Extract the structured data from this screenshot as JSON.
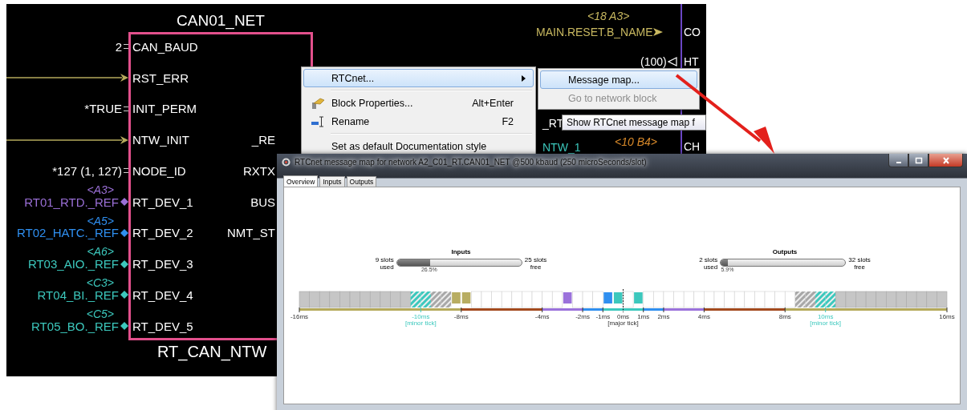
{
  "schematic": {
    "block_title": "CAN01_NET",
    "block_type": "RT_CAN_NTW",
    "pins": [
      {
        "name": "CAN_BAUD",
        "kind": "const",
        "value": "2"
      },
      {
        "name": "RST_ERR",
        "kind": "wire"
      },
      {
        "name": "INIT_PERM",
        "kind": "const",
        "value": "*TRUE"
      },
      {
        "name": "NTW_INIT",
        "kind": "wire",
        "output": "_RE"
      },
      {
        "name": "NODE_ID",
        "kind": "const",
        "value": "*127 (1, 127)",
        "output": "RXTX"
      },
      {
        "name": "RT_DEV_1",
        "kind": "ref",
        "tag": "<A3>",
        "value": "RT01_RTD._REF",
        "color": "#9a6fd6",
        "output": "BUS"
      },
      {
        "name": "RT_DEV_2",
        "kind": "ref",
        "tag": "<A5>",
        "value": "RT02_HATC._REF",
        "color": "#2f8ff0",
        "output": "NMT_ST"
      },
      {
        "name": "RT_DEV_3",
        "kind": "ref",
        "tag": "<A6>",
        "value": "RT03_AIO._REF",
        "color": "#3cc8bd"
      },
      {
        "name": "RT_DEV_4",
        "kind": "ref",
        "tag": "<C3>",
        "value": "RT04_BI._REF",
        "color": "#3cc8bd"
      },
      {
        "name": "RT_DEV_5",
        "kind": "ref",
        "tag": "<C5>",
        "value": "RT05_BO._REF",
        "color": "#3cc8bd"
      }
    ],
    "fragments": [
      {
        "text": "<18 A3>",
        "kind": "tag",
        "color": "#c8b860"
      },
      {
        "text": "MAIN.RESET.B_NAME",
        "kind": "input",
        "color": "#c8b860"
      },
      {
        "text": "CO",
        "kind": "pin"
      },
      {
        "text": "(100)",
        "kind": "output"
      },
      {
        "text": "HT",
        "kind": "pin"
      },
      {
        "text": "_RT",
        "kind": "pin"
      },
      {
        "text": "NTW_1",
        "kind": "pin",
        "color": "#3cc8bd"
      },
      {
        "text": "<10 B4>",
        "kind": "tag",
        "color": "#d98a2a"
      },
      {
        "text": "CH",
        "kind": "pin"
      }
    ]
  },
  "context_menu": {
    "items": [
      {
        "kind": "item",
        "label": "RTCnet...",
        "submenu": true,
        "selected": true
      },
      {
        "kind": "separator"
      },
      {
        "kind": "item",
        "label": "Block Properties...",
        "shortcut": "Alt+Enter",
        "selected": false
      },
      {
        "kind": "item",
        "label": "Rename",
        "shortcut": "F2",
        "selected": false
      },
      {
        "kind": "separator"
      },
      {
        "kind": "item",
        "label": "Set as default  Documentation style",
        "selected": false
      }
    ]
  },
  "submenu": {
    "items": [
      {
        "label": "Message map...",
        "selected": true,
        "disabled": false
      },
      {
        "label": "Go to network block",
        "selected": false,
        "disabled": true
      }
    ]
  },
  "tooltip": "Show RTCnet message map f",
  "message_map_window": {
    "title": "RTCnet message map for network A2_C01_RT.CAN01_NET @500 kbaud (250 microSeconds/slot)",
    "tabs": [
      {
        "label": "Overview",
        "selected": true
      },
      {
        "label": "Inputs",
        "selected": false
      },
      {
        "label": "Outputs",
        "selected": false
      }
    ],
    "gauges": [
      {
        "title": "Inputs",
        "used": "9 slots",
        "used_caption": "used",
        "level": 0.265,
        "percent": "26.5%",
        "free": "25 slots",
        "free_caption": "free"
      },
      {
        "title": "Outputs",
        "used": "2 slots",
        "used_caption": "used",
        "level": 0.059,
        "percent": "5.9%",
        "free": "32 slots",
        "free_caption": "free"
      }
    ],
    "timeline": {
      "end_tick": "16ms",
      "bands": [
        {
          "color": "#b5aa5c",
          "slots": [
            {
              "kind": "reserved",
              "tick": {
                "label": "-16ms",
                "kind": "plain"
              }
            },
            {
              "kind": "reserved"
            },
            {
              "kind": "reserved"
            },
            {
              "kind": "reserved"
            },
            {
              "kind": "reserved"
            },
            {
              "kind": "reserved"
            },
            {
              "kind": "reserved"
            },
            {
              "kind": "reserved"
            },
            {
              "kind": "reserved"
            },
            {
              "kind": "reserved"
            },
            {
              "kind": "reserved"
            },
            {
              "kind": "hatched",
              "color": "#3cc8bd"
            },
            {
              "kind": "hatched",
              "color": "#3cc8bd",
              "tick": {
                "label": "-10ms",
                "kind": "minor",
                "note": "[minor tick]"
              }
            },
            {
              "kind": "hatched",
              "color": "#a8a8a8"
            },
            {
              "kind": "hatched",
              "color": "#a8a8a8"
            },
            {
              "kind": "message",
              "color": "#b8ad62"
            }
          ]
        },
        {
          "color": "#a34a1e",
          "slots": [
            {
              "kind": "message",
              "color": "#b8ad62",
              "tick": {
                "label": "-8ms",
                "kind": "plain"
              }
            },
            {
              "kind": "free"
            },
            {
              "kind": "free"
            },
            {
              "kind": "free"
            },
            {
              "kind": "free"
            },
            {
              "kind": "free"
            },
            {
              "kind": "free"
            },
            {
              "kind": "free"
            }
          ]
        },
        {
          "color": "#9b72db",
          "slots": [
            {
              "kind": "free",
              "tick": {
                "label": "-4ms",
                "kind": "plain"
              }
            },
            {
              "kind": "free"
            },
            {
              "kind": "message",
              "color": "#9b72db"
            },
            {
              "kind": "free"
            }
          ]
        },
        {
          "color": "#2f8ff0",
          "slots": [
            {
              "kind": "free",
              "tick": {
                "label": "-2ms",
                "kind": "plain"
              }
            },
            {
              "kind": "free"
            }
          ]
        },
        {
          "color": "#3cc8bd",
          "slots": [
            {
              "kind": "message",
              "color": "#2f8ff0",
              "tick": {
                "label": "-1ms",
                "kind": "plain"
              }
            },
            {
              "kind": "message",
              "color": "#3cc8bd"
            },
            {
              "kind": "free",
              "tick": {
                "label": "0ms",
                "kind": "major",
                "note": "[major tick]"
              }
            },
            {
              "kind": "message",
              "color": "#3cc8bd"
            }
          ]
        },
        {
          "color": "#2f8ff0",
          "slots": [
            {
              "kind": "free",
              "tick": {
                "label": "1ms",
                "kind": "plain"
              }
            },
            {
              "kind": "free"
            }
          ]
        },
        {
          "color": "#9b72db",
          "slots": [
            {
              "kind": "free",
              "tick": {
                "label": "2ms",
                "kind": "plain"
              }
            },
            {
              "kind": "free"
            },
            {
              "kind": "free"
            },
            {
              "kind": "free"
            }
          ]
        },
        {
          "color": "#a34a1e",
          "slots": [
            {
              "kind": "free",
              "tick": {
                "label": "4ms",
                "kind": "plain"
              }
            },
            {
              "kind": "free"
            },
            {
              "kind": "free"
            },
            {
              "kind": "free"
            },
            {
              "kind": "free"
            },
            {
              "kind": "free"
            },
            {
              "kind": "free"
            },
            {
              "kind": "free"
            }
          ]
        },
        {
          "color": "#b5aa5c",
          "slots": [
            {
              "kind": "free",
              "tick": {
                "label": "8ms",
                "kind": "plain"
              }
            },
            {
              "kind": "hatched",
              "color": "#a8a8a8"
            },
            {
              "kind": "hatched",
              "color": "#a8a8a8"
            },
            {
              "kind": "hatched",
              "color": "#3cc8bd"
            },
            {
              "kind": "hatched",
              "color": "#3cc8bd",
              "tick": {
                "label": "10ms",
                "kind": "minor",
                "note": "[minor tick]"
              }
            },
            {
              "kind": "reserved"
            },
            {
              "kind": "reserved"
            },
            {
              "kind": "reserved"
            },
            {
              "kind": "reserved"
            },
            {
              "kind": "reserved"
            },
            {
              "kind": "reserved"
            },
            {
              "kind": "reserved"
            },
            {
              "kind": "reserved"
            },
            {
              "kind": "reserved"
            },
            {
              "kind": "reserved"
            },
            {
              "kind": "reserved"
            }
          ]
        }
      ]
    }
  }
}
